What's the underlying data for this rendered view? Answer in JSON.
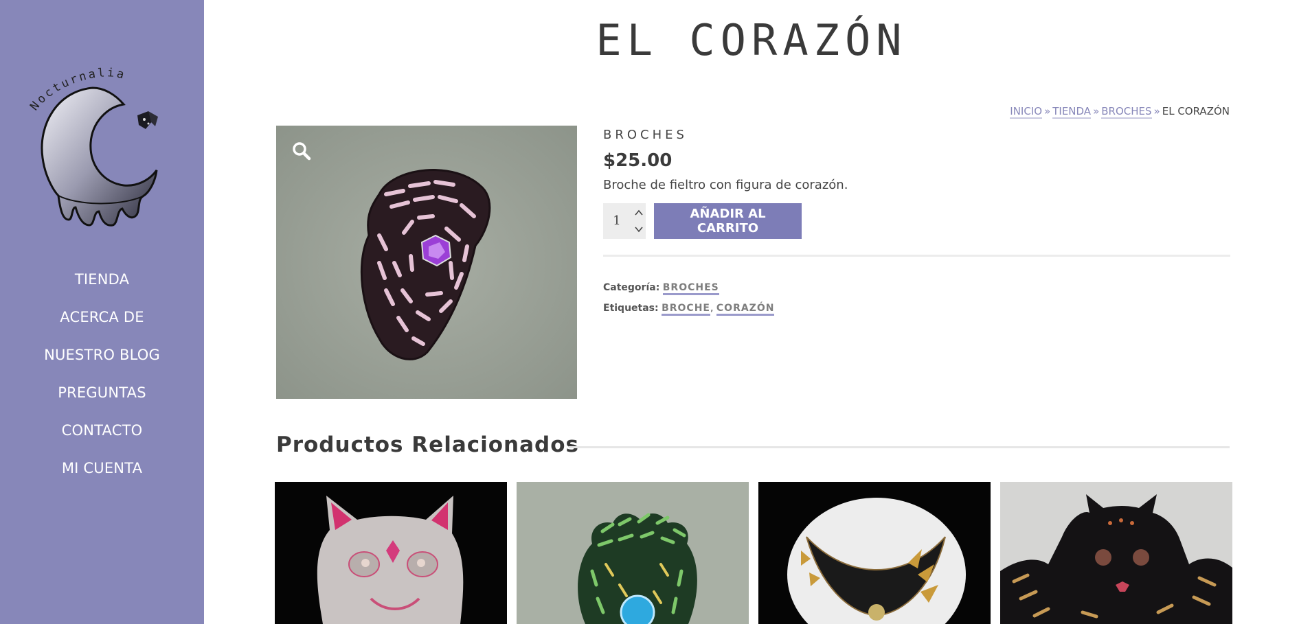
{
  "brand": {
    "logo_text": "Nocturnalia"
  },
  "nav": {
    "items": [
      {
        "label": "TIENDA"
      },
      {
        "label": "ACERCA DE"
      },
      {
        "label": "NUESTRO BLOG"
      },
      {
        "label": "PREGUNTAS"
      },
      {
        "label": "CONTACTO"
      },
      {
        "label": "MI CUENTA"
      }
    ]
  },
  "page": {
    "title": "EL CORAZÓN"
  },
  "breadcrumb": {
    "items": [
      "INICIO",
      "TIENDA",
      "BROCHES"
    ],
    "current": "EL CORAZÓN",
    "separator": "»"
  },
  "product": {
    "category_title": "BROCHES",
    "price": "$25.00",
    "description": "Broche de fieltro con figura de corazón.",
    "quantity": "1",
    "add_to_cart_label": "AÑADIR AL CARRITO",
    "category_label": "Categoría:",
    "category_value": "BROCHES",
    "tags_label": "Etiquetas:",
    "tags": [
      "BROCHE",
      "CORAZÓN"
    ],
    "tags_separator": ","
  },
  "related": {
    "title": "Productos Relacionados"
  },
  "colors": {
    "sidebar": "#8787b9",
    "button": "#7d7db7",
    "text": "#444444"
  }
}
